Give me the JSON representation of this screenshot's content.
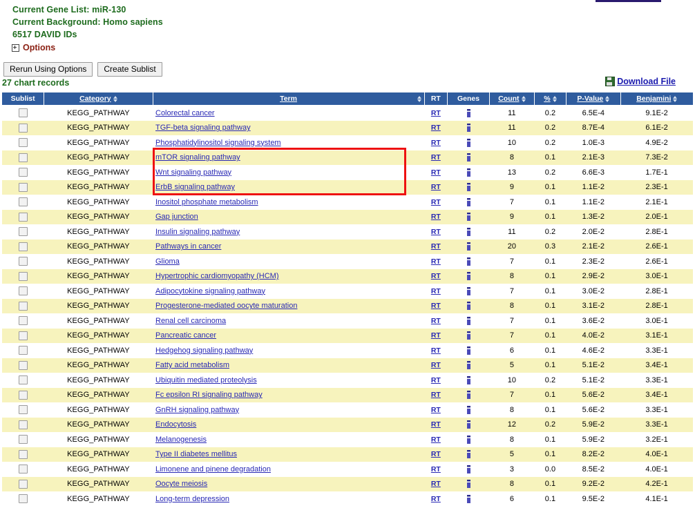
{
  "header": {
    "gene_list_line": "Current Gene List: miR-130",
    "background_line": "Current Background: Homo sapiens",
    "ids_line": "6517 DAVID IDs",
    "options_label": "Options",
    "options_icon": "expand-plus-icon"
  },
  "buttons": {
    "rerun_label": "Rerun Using Options",
    "create_sublist_label": "Create Sublist"
  },
  "toolbar": {
    "records_label": "27 chart records",
    "download_label": "Download File",
    "download_icon": "save-floppy-icon"
  },
  "table": {
    "columns": [
      {
        "key": "sublist",
        "label": "Sublist",
        "sortable": false,
        "underline": false
      },
      {
        "key": "category",
        "label": "Category",
        "sortable": true,
        "underline": true
      },
      {
        "key": "term",
        "label": "Term",
        "sortable": true,
        "underline": true
      },
      {
        "key": "rt",
        "label": "RT",
        "sortable": false,
        "underline": false
      },
      {
        "key": "genes",
        "label": "Genes",
        "sortable": false,
        "underline": false
      },
      {
        "key": "count",
        "label": "Count",
        "sortable": true,
        "underline": true
      },
      {
        "key": "percent",
        "label": "%",
        "sortable": true,
        "underline": true
      },
      {
        "key": "pvalue",
        "label": "P-Value",
        "sortable": true,
        "underline": true
      },
      {
        "key": "benjamini",
        "label": "Benjamini",
        "sortable": true,
        "underline": true
      }
    ],
    "rt_label": "RT",
    "rows": [
      {
        "category": "KEGG_PATHWAY",
        "term": "Colorectal cancer",
        "count": "11",
        "percent": "0.2",
        "pvalue": "6.5E-4",
        "benjamini": "9.1E-2"
      },
      {
        "category": "KEGG_PATHWAY",
        "term": "TGF-beta signaling pathway",
        "count": "11",
        "percent": "0.2",
        "pvalue": "8.7E-4",
        "benjamini": "6.1E-2"
      },
      {
        "category": "KEGG_PATHWAY",
        "term": "Phosphatidylinositol signaling system",
        "count": "10",
        "percent": "0.2",
        "pvalue": "1.0E-3",
        "benjamini": "4.9E-2"
      },
      {
        "category": "KEGG_PATHWAY",
        "term": "mTOR signaling pathway",
        "count": "8",
        "percent": "0.1",
        "pvalue": "2.1E-3",
        "benjamini": "7.3E-2"
      },
      {
        "category": "KEGG_PATHWAY",
        "term": "Wnt signaling pathway",
        "count": "13",
        "percent": "0.2",
        "pvalue": "6.6E-3",
        "benjamini": "1.7E-1"
      },
      {
        "category": "KEGG_PATHWAY",
        "term": "ErbB signaling pathway",
        "count": "9",
        "percent": "0.1",
        "pvalue": "1.1E-2",
        "benjamini": "2.3E-1"
      },
      {
        "category": "KEGG_PATHWAY",
        "term": "Inositol phosphate metabolism",
        "count": "7",
        "percent": "0.1",
        "pvalue": "1.1E-2",
        "benjamini": "2.1E-1"
      },
      {
        "category": "KEGG_PATHWAY",
        "term": "Gap junction",
        "count": "9",
        "percent": "0.1",
        "pvalue": "1.3E-2",
        "benjamini": "2.0E-1"
      },
      {
        "category": "KEGG_PATHWAY",
        "term": "Insulin signaling pathway",
        "count": "11",
        "percent": "0.2",
        "pvalue": "2.0E-2",
        "benjamini": "2.8E-1"
      },
      {
        "category": "KEGG_PATHWAY",
        "term": "Pathways in cancer",
        "count": "20",
        "percent": "0.3",
        "pvalue": "2.1E-2",
        "benjamini": "2.6E-1"
      },
      {
        "category": "KEGG_PATHWAY",
        "term": "Glioma",
        "count": "7",
        "percent": "0.1",
        "pvalue": "2.3E-2",
        "benjamini": "2.6E-1"
      },
      {
        "category": "KEGG_PATHWAY",
        "term": "Hypertrophic cardiomyopathy (HCM)",
        "count": "8",
        "percent": "0.1",
        "pvalue": "2.9E-2",
        "benjamini": "3.0E-1"
      },
      {
        "category": "KEGG_PATHWAY",
        "term": "Adipocytokine signaling pathway",
        "count": "7",
        "percent": "0.1",
        "pvalue": "3.0E-2",
        "benjamini": "2.8E-1"
      },
      {
        "category": "KEGG_PATHWAY",
        "term": "Progesterone-mediated oocyte maturation",
        "count": "8",
        "percent": "0.1",
        "pvalue": "3.1E-2",
        "benjamini": "2.8E-1"
      },
      {
        "category": "KEGG_PATHWAY",
        "term": "Renal cell carcinoma",
        "count": "7",
        "percent": "0.1",
        "pvalue": "3.6E-2",
        "benjamini": "3.0E-1"
      },
      {
        "category": "KEGG_PATHWAY",
        "term": "Pancreatic cancer",
        "count": "7",
        "percent": "0.1",
        "pvalue": "4.0E-2",
        "benjamini": "3.1E-1"
      },
      {
        "category": "KEGG_PATHWAY",
        "term": "Hedgehog signaling pathway",
        "count": "6",
        "percent": "0.1",
        "pvalue": "4.6E-2",
        "benjamini": "3.3E-1"
      },
      {
        "category": "KEGG_PATHWAY",
        "term": "Fatty acid metabolism",
        "count": "5",
        "percent": "0.1",
        "pvalue": "5.1E-2",
        "benjamini": "3.4E-1"
      },
      {
        "category": "KEGG_PATHWAY",
        "term": "Ubiquitin mediated proteolysis",
        "count": "10",
        "percent": "0.2",
        "pvalue": "5.1E-2",
        "benjamini": "3.3E-1"
      },
      {
        "category": "KEGG_PATHWAY",
        "term": "Fc epsilon RI signaling pathway",
        "count": "7",
        "percent": "0.1",
        "pvalue": "5.6E-2",
        "benjamini": "3.4E-1"
      },
      {
        "category": "KEGG_PATHWAY",
        "term": "GnRH signaling pathway",
        "count": "8",
        "percent": "0.1",
        "pvalue": "5.6E-2",
        "benjamini": "3.3E-1"
      },
      {
        "category": "KEGG_PATHWAY",
        "term": "Endocytosis",
        "count": "12",
        "percent": "0.2",
        "pvalue": "5.9E-2",
        "benjamini": "3.3E-1"
      },
      {
        "category": "KEGG_PATHWAY",
        "term": "Melanogenesis",
        "count": "8",
        "percent": "0.1",
        "pvalue": "5.9E-2",
        "benjamini": "3.2E-1"
      },
      {
        "category": "KEGG_PATHWAY",
        "term": "Type II diabetes mellitus",
        "count": "5",
        "percent": "0.1",
        "pvalue": "8.2E-2",
        "benjamini": "4.0E-1"
      },
      {
        "category": "KEGG_PATHWAY",
        "term": "Limonene and pinene degradation",
        "count": "3",
        "percent": "0.0",
        "pvalue": "8.5E-2",
        "benjamini": "4.0E-1"
      },
      {
        "category": "KEGG_PATHWAY",
        "term": "Oocyte meiosis",
        "count": "8",
        "percent": "0.1",
        "pvalue": "9.2E-2",
        "benjamini": "4.2E-1"
      },
      {
        "category": "KEGG_PATHWAY",
        "term": "Long-term depression",
        "count": "6",
        "percent": "0.1",
        "pvalue": "9.5E-2",
        "benjamini": "4.1E-1"
      }
    ]
  },
  "annotation": {
    "highlight_color": "#ee1111",
    "highlighted_terms": [
      "mTOR signaling pathway",
      "Wnt signaling pathway",
      "ErbB signaling pathway"
    ]
  },
  "colors": {
    "header_green": "#1d6b1d",
    "options_red": "#8b2114",
    "table_header_blue": "#2f5c9e",
    "row_alt_yellow": "#f7f3bd",
    "link_blue": "#2828b4"
  }
}
